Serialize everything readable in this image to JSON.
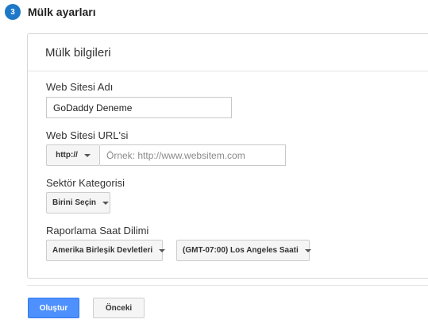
{
  "step": {
    "number": "3",
    "title": "Mülk ayarları"
  },
  "card": {
    "title": "Mülk bilgileri"
  },
  "site_name": {
    "label": "Web Sitesi Adı",
    "value": "GoDaddy Deneme"
  },
  "site_url": {
    "label": "Web Sitesi URL'si",
    "protocol": "http://",
    "placeholder": "Örnek: http://www.websitem.com"
  },
  "category": {
    "label": "Sektör Kategorisi",
    "selected": "Birini Seçin"
  },
  "timezone": {
    "label": "Raporlama Saat Dilimi",
    "country": "Amerika Birleşik Devletleri",
    "zone": "(GMT-07:00) Los Angeles Saati"
  },
  "actions": {
    "create_label": "Oluştur",
    "back_label": "Önceki"
  },
  "colors": {
    "step_badge": "#1e78c8",
    "primary_button": "#4d90fe"
  }
}
